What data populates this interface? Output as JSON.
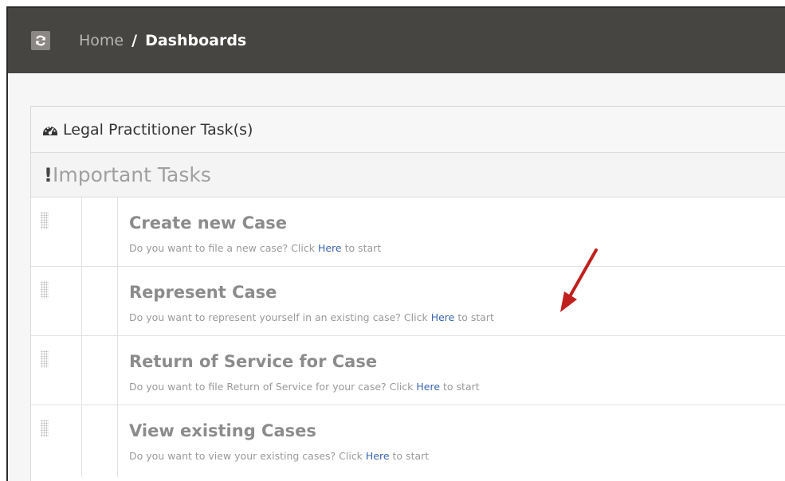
{
  "topbar": {
    "refresh_icon": "refresh-icon",
    "breadcrumb": {
      "home": "Home",
      "separator": "/",
      "current": "Dashboards"
    }
  },
  "panel": {
    "icon": "dashboard-icon",
    "title": "Legal Practitioner Task(s)"
  },
  "section": {
    "icon": "exclamation-icon",
    "title": "Important Tasks"
  },
  "tasks": [
    {
      "title": "Create new Case",
      "desc_before": "Do you want to file a new case? Click ",
      "link": "Here",
      "desc_after": " to start"
    },
    {
      "title": "Represent Case",
      "desc_before": "Do you want to represent yourself in an existing case? Click ",
      "link": "Here",
      "desc_after": " to start"
    },
    {
      "title": "Return of Service for Case",
      "desc_before": "Do you want to file Return of Service for your case? Click ",
      "link": "Here",
      "desc_after": " to start"
    },
    {
      "title": "View existing Cases",
      "desc_before": "Do you want to view your existing cases? Click ",
      "link": "Here",
      "desc_after": " to start"
    }
  ],
  "colors": {
    "topbar": "#474542",
    "link": "#3a66b0",
    "arrow": "#c0201e"
  }
}
